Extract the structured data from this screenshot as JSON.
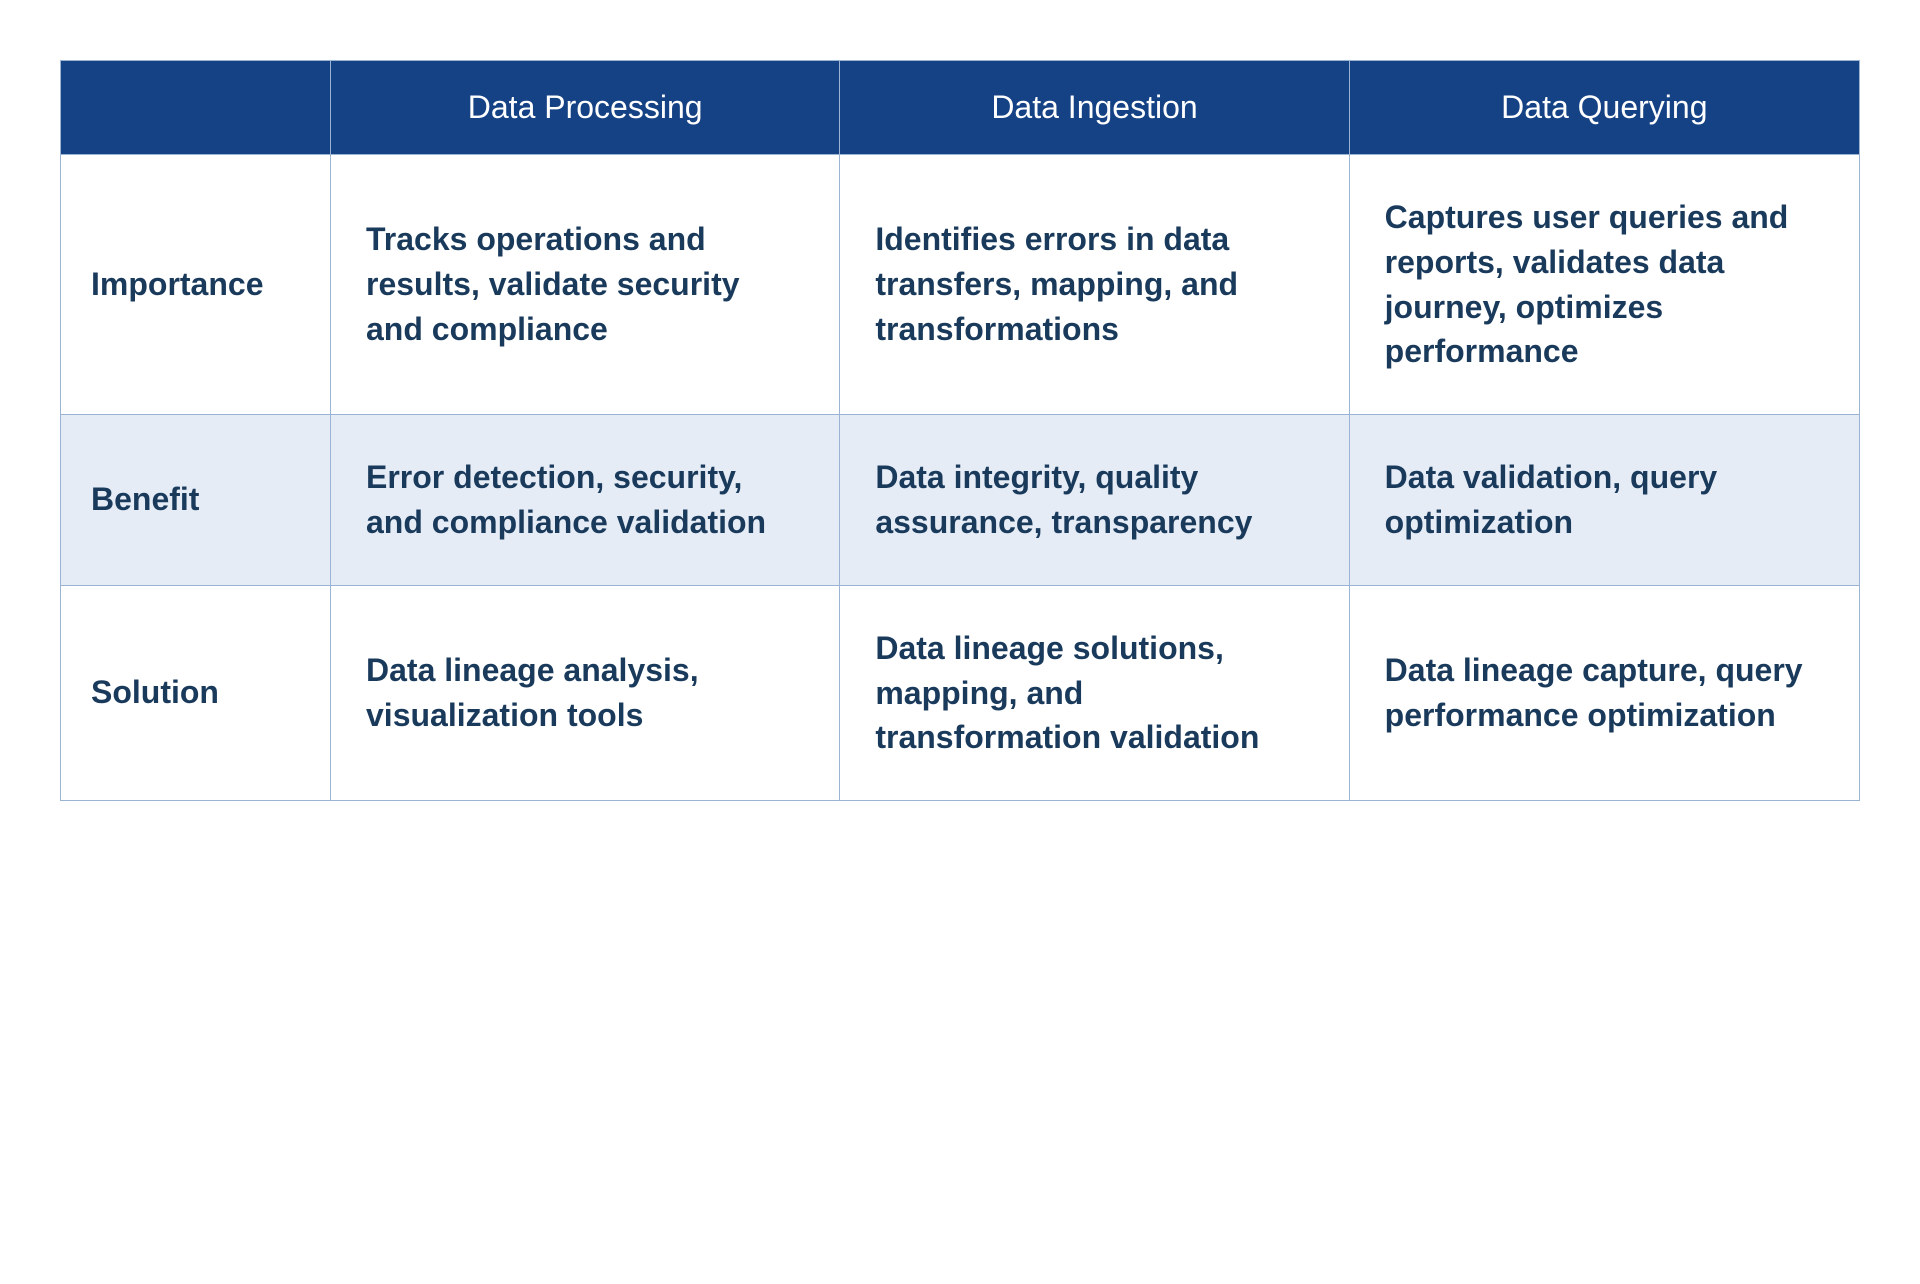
{
  "headers": {
    "col1": "Data Processing",
    "col2": "Data Ingestion",
    "col3": "Data Querying"
  },
  "rows": [
    {
      "label": "Importance",
      "cells": [
        "Tracks operations and results, validate security and compliance",
        "Identifies errors in data transfers, mapping, and transformations",
        "Captures user queries and reports, validates data journey, optimizes performance"
      ]
    },
    {
      "label": "Benefit",
      "cells": [
        "Error detection, security, and compliance validation",
        "Data integrity, quality assurance, transparency",
        "Data validation, query optimization"
      ]
    },
    {
      "label": "Solution",
      "cells": [
        "Data lineage analysis, visualization tools",
        "Data lineage solutions, mapping, and transformation validation",
        "Data lineage capture, query performance optimization"
      ]
    }
  ]
}
